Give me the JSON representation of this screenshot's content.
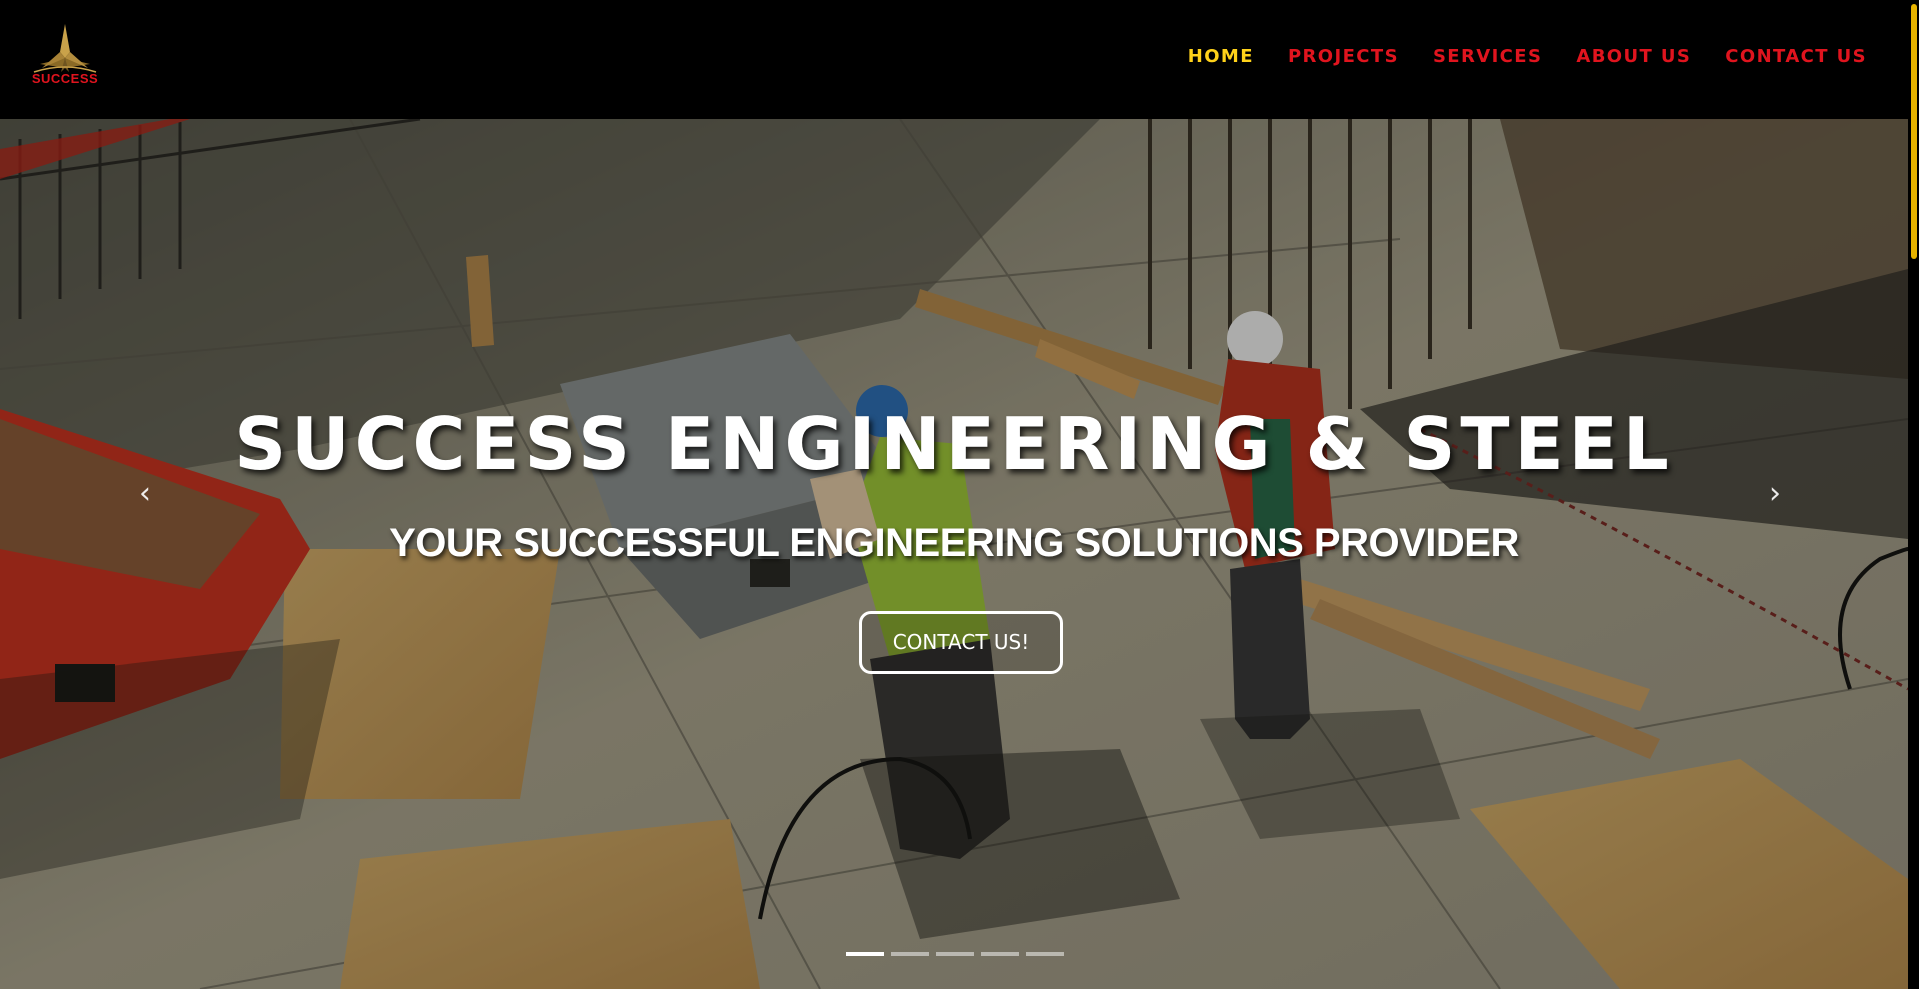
{
  "brand": {
    "logo_text": "SUCCESS"
  },
  "nav": {
    "items": [
      {
        "label": "HOME",
        "active": true
      },
      {
        "label": "PROJECTS",
        "active": false
      },
      {
        "label": "SERVICES",
        "active": false
      },
      {
        "label": "ABOUT US",
        "active": false
      },
      {
        "label": "CONTACT US",
        "active": false
      }
    ]
  },
  "hero": {
    "title": "SUCCESS ENGINEERING & STEEL",
    "subtitle": "YOUR SUCCESSFUL ENGINEERING SOLUTIONS PROVIDER",
    "cta_label": "CONTACT US!",
    "prev_icon": "‹",
    "next_icon": "›",
    "slide_count": 5,
    "active_slide": 1
  },
  "colors": {
    "accent": "#ffd21a",
    "brand_red": "#e0141e",
    "nav_bg": "#000000",
    "scroll_thumb": "#e8b400"
  },
  "icons": {
    "prev": "chevron-left-icon",
    "next": "chevron-right-icon",
    "logo": "star-logo-icon"
  }
}
